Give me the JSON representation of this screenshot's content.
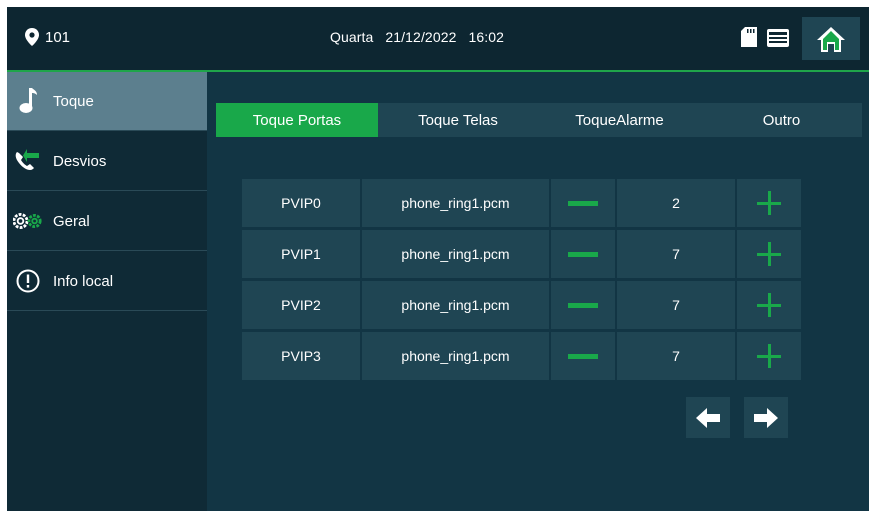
{
  "header": {
    "room_number": "101",
    "day": "Quarta",
    "date": "21/12/2022",
    "time": "16:02",
    "icons": [
      "location-pin-icon",
      "sd-card-icon",
      "storage-icon",
      "home-icon"
    ]
  },
  "sidebar": {
    "items": [
      {
        "label": "Toque",
        "icon": "music-note-icon",
        "active": true
      },
      {
        "label": "Desvios",
        "icon": "call-forward-icon",
        "active": false
      },
      {
        "label": "Geral",
        "icon": "gears-icon",
        "active": false
      },
      {
        "label": "Info local",
        "icon": "info-icon",
        "active": false
      }
    ]
  },
  "tabs": [
    {
      "label": "Toque Portas",
      "active": true
    },
    {
      "label": "Toque Telas",
      "active": false
    },
    {
      "label": "ToqueAlarme",
      "active": false
    },
    {
      "label": "Outro",
      "active": false
    }
  ],
  "ring_table": {
    "rows": [
      {
        "device": "PVIP0",
        "file": "phone_ring1.pcm",
        "volume": "2"
      },
      {
        "device": "PVIP1",
        "file": "phone_ring1.pcm",
        "volume": "7"
      },
      {
        "device": "PVIP2",
        "file": "phone_ring1.pcm",
        "volume": "7"
      },
      {
        "device": "PVIP3",
        "file": "phone_ring1.pcm",
        "volume": "7"
      }
    ]
  },
  "pagination": {
    "prev_icon": "arrow-left-icon",
    "next_icon": "arrow-right-icon"
  },
  "colors": {
    "accent": "#19a84a",
    "panel": "#1f4553",
    "background": "#0f2a36",
    "active_sidebar": "#5c7f8e"
  }
}
